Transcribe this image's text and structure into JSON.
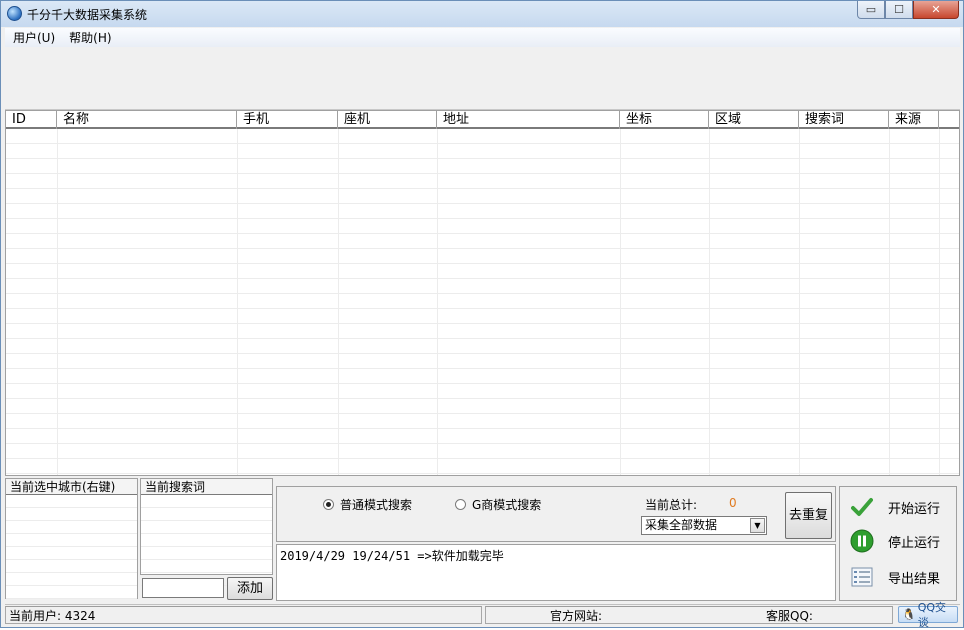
{
  "window": {
    "title": "千分千大数据采集系统",
    "minimize": "▭",
    "maximize": "☐",
    "close": "✕"
  },
  "menu": {
    "user": "用户(U)",
    "help": "帮助(H)"
  },
  "grid": {
    "columns": [
      "ID",
      "名称",
      "手机",
      "座机",
      "地址",
      "坐标",
      "区域",
      "搜索词",
      "来源"
    ]
  },
  "city_panel": {
    "header": "当前选中城市(右键)"
  },
  "word_panel": {
    "header": "当前搜索词",
    "add_label": "添加",
    "input_value": ""
  },
  "options": {
    "radio_normal": "普通模式搜索",
    "radio_g": "G商模式搜索",
    "total_label": "当前总计:",
    "total_value": "0",
    "select_value": "采集全部数据",
    "dedupe_label": "去重复"
  },
  "log": {
    "line1": "2019/4/29 19/24/51 =>软件加载完毕"
  },
  "actions": {
    "start": "开始运行",
    "stop": "停止运行",
    "export": "导出结果"
  },
  "status": {
    "user": "当前用户: 4324",
    "site": "官方网站:",
    "qq_service": "客服QQ:",
    "qq_chat": "QQ交谈"
  },
  "colors": {
    "accent": "#2c6fc0",
    "total": "#e07a1f",
    "ok_green": "#3aa23a"
  }
}
